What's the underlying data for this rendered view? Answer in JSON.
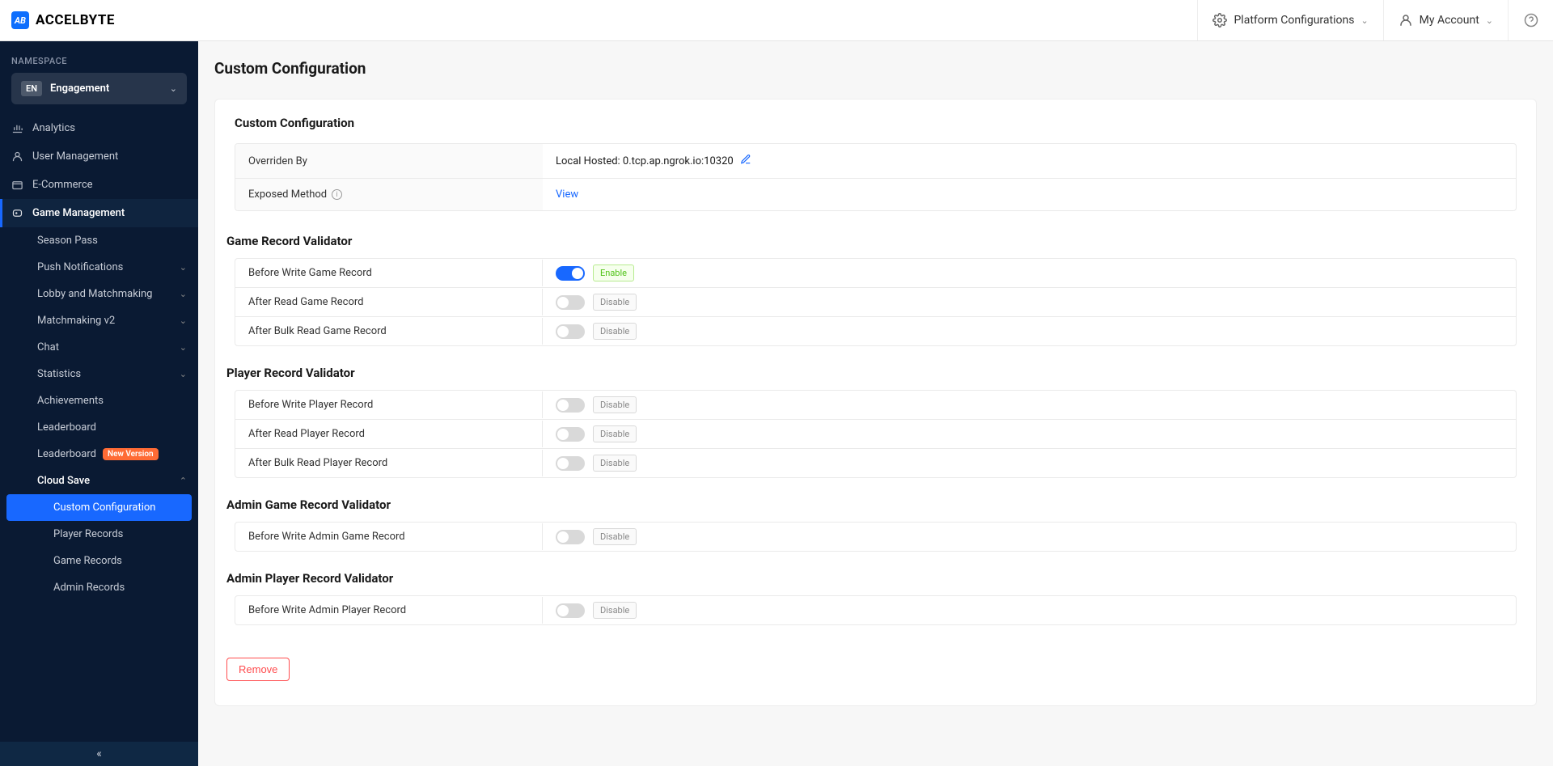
{
  "brand": {
    "logo_text": "AB",
    "name": "ACCELBYTE"
  },
  "topbar": {
    "platform_config": "Platform Configurations",
    "my_account": "My Account"
  },
  "sidebar": {
    "namespace_label": "NAMESPACE",
    "namespace_badge": "EN",
    "namespace_name": "Engagement",
    "items": [
      {
        "label": "Analytics"
      },
      {
        "label": "User Management"
      },
      {
        "label": "E-Commerce"
      },
      {
        "label": "Game Management"
      }
    ],
    "gm_children": [
      {
        "label": "Season Pass",
        "chevron": false
      },
      {
        "label": "Push Notifications",
        "chevron": true
      },
      {
        "label": "Lobby and Matchmaking",
        "chevron": true
      },
      {
        "label": "Matchmaking v2",
        "chevron": true
      },
      {
        "label": "Chat",
        "chevron": true
      },
      {
        "label": "Statistics",
        "chevron": true
      },
      {
        "label": "Achievements",
        "chevron": false
      },
      {
        "label": "Leaderboard",
        "chevron": false
      },
      {
        "label": "Leaderboard",
        "chevron": false,
        "badge": "New Version"
      },
      {
        "label": "Cloud Save",
        "chevron": true,
        "expanded": true
      }
    ],
    "cloud_save_children": [
      {
        "label": "Custom Configuration",
        "active": true
      },
      {
        "label": "Player Records"
      },
      {
        "label": "Game Records"
      },
      {
        "label": "Admin Records"
      }
    ]
  },
  "page": {
    "title": "Custom Configuration",
    "card_title": "Custom Configuration",
    "info": {
      "overridden_by_label": "Overriden By",
      "overridden_by_value": "Local Hosted: 0.tcp.ap.ngrok.io:10320",
      "exposed_method_label": "Exposed Method",
      "exposed_method_value": "View"
    },
    "sections": [
      {
        "title": "Game Record Validator",
        "rows": [
          {
            "label": "Before Write Game Record",
            "on": true,
            "status": "Enable"
          },
          {
            "label": "After Read Game Record",
            "on": false,
            "status": "Disable"
          },
          {
            "label": "After Bulk Read Game Record",
            "on": false,
            "status": "Disable"
          }
        ]
      },
      {
        "title": "Player Record Validator",
        "rows": [
          {
            "label": "Before Write Player Record",
            "on": false,
            "status": "Disable"
          },
          {
            "label": "After Read Player Record",
            "on": false,
            "status": "Disable"
          },
          {
            "label": "After Bulk Read Player Record",
            "on": false,
            "status": "Disable"
          }
        ]
      },
      {
        "title": "Admin Game Record Validator",
        "rows": [
          {
            "label": "Before Write Admin Game Record",
            "on": false,
            "status": "Disable"
          }
        ]
      },
      {
        "title": "Admin Player Record Validator",
        "rows": [
          {
            "label": "Before Write Admin Player Record",
            "on": false,
            "status": "Disable"
          }
        ]
      }
    ],
    "remove_btn": "Remove"
  }
}
